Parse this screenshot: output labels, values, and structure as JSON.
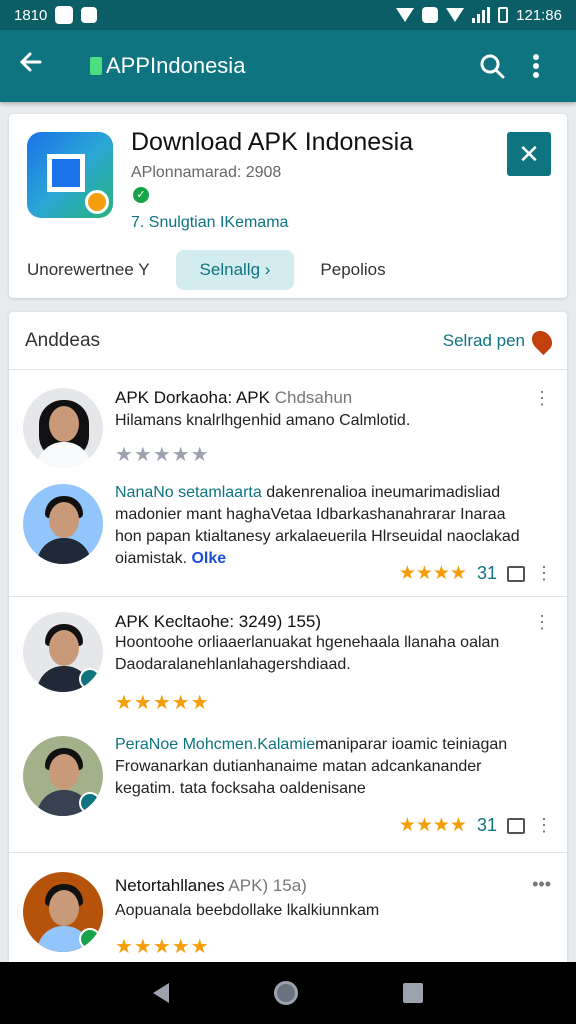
{
  "status": {
    "time_left": "1810",
    "time_right": "121:86"
  },
  "appbar": {
    "title": "APPIndonesia"
  },
  "app": {
    "title": "Download APK Indonesia",
    "subtitle": "APlonnamarad: 2908",
    "dev": "7. Snulgtian IKemama",
    "tabs": [
      "Unorewertnee Y",
      "Selnallg ›",
      "Pepolios"
    ]
  },
  "reviews_section": {
    "heading": "Anddeas",
    "see_all": "Selrad pen"
  },
  "reviews": [
    {
      "name": "APK Dorkaoha: APK",
      "name_grey": "Chdsahun",
      "text": "Hilamans knalrlhgenhid amano Calmlotid.",
      "stars": "★★★★★"
    },
    {
      "text_highlight": "NanaNo setamlaarta",
      "text": "dakenrenalioa ineumarimadisliad madonier mant haghaVetaa Idbarkashanahrarar Inaraa hon papan ktialtanesy arkalaeuerila Hlrseuidal naoclakad oiamistak.",
      "tag": "Olke",
      "rating": "31"
    },
    {
      "name": "APK Kecltaohe: 3249) 155)",
      "text": "Hoontoohe orliaaerlanuakat hgenehaala llanaha oalan Daodaralanehlanlahagershdiaad.",
      "stars": "★★★★★"
    },
    {
      "text_highlight": "PeraNoe Mohcmen.Kalamie",
      "text": "maniparar ioamic teiniagan Frowanarkan dutianhanaime matan adcankanander kegatim. tata focksaha oaldenisane",
      "rating": "31"
    },
    {
      "name": "Netortahllanes",
      "name_grey": "APK) 15a)",
      "text": "Aopuanala beebdollake lkalkiunnkam",
      "stars": "★★★★★"
    }
  ],
  "colors": {
    "primary": "#0e7480",
    "star": "#f59e0b"
  }
}
